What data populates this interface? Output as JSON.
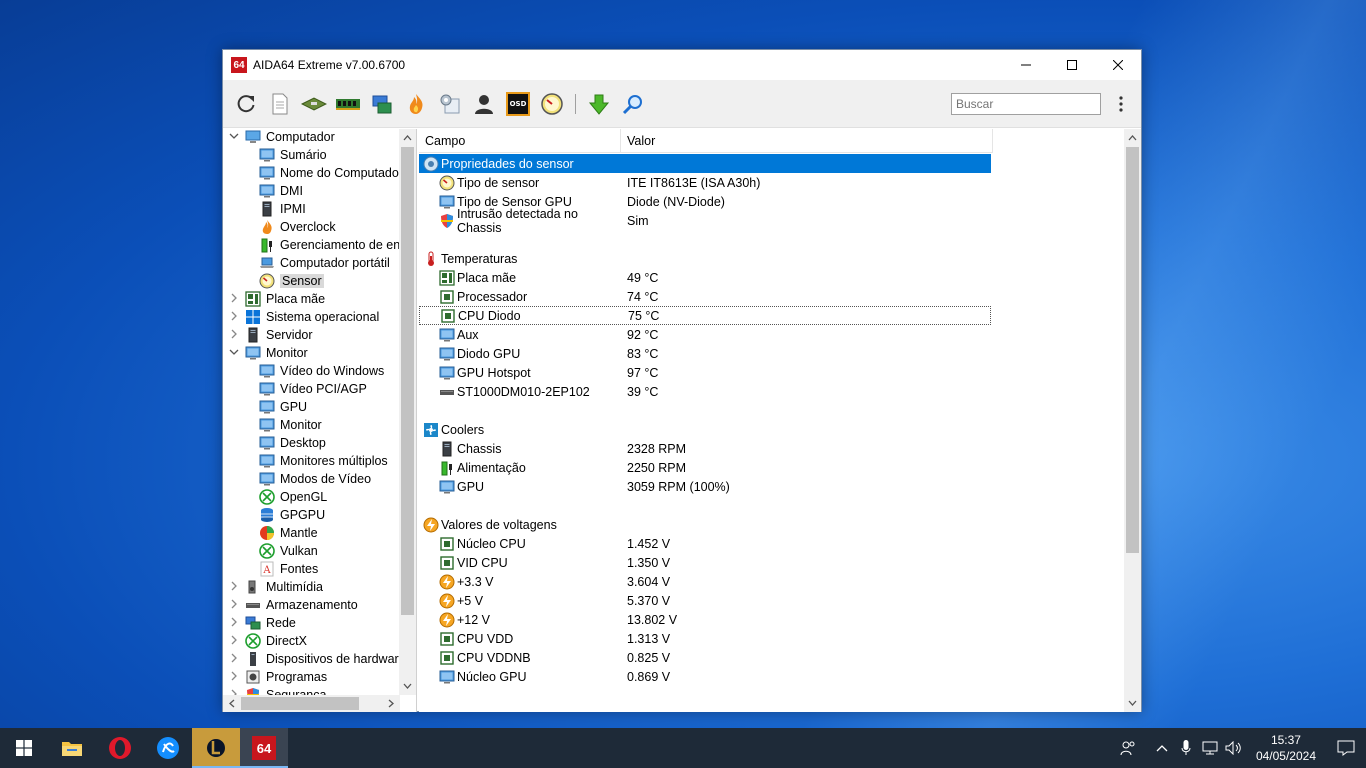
{
  "window": {
    "logo": "64",
    "title": "AIDA64 Extreme v7.00.6700"
  },
  "toolbar": {
    "search_placeholder": "Buscar",
    "buttons": [
      "refresh-icon",
      "report-icon",
      "motherboard-icon",
      "memory-icon",
      "network-icon",
      "flame-icon",
      "tools-icon",
      "user-icon",
      "osd-icon",
      "gauge-icon",
      "download-icon",
      "search-icon"
    ],
    "osd_label": "OSD"
  },
  "tree": {
    "items": [
      {
        "label": "Computador",
        "level": 0,
        "expanded": true,
        "icon": "computer-icon"
      },
      {
        "label": "Sumário",
        "level": 1,
        "icon": "monitor-icon"
      },
      {
        "label": "Nome do Computador",
        "level": 1,
        "icon": "monitor-icon"
      },
      {
        "label": "DMI",
        "level": 1,
        "icon": "monitor-icon"
      },
      {
        "label": "IPMI",
        "level": 1,
        "icon": "server-icon"
      },
      {
        "label": "Overclock",
        "level": 1,
        "icon": "flame-icon"
      },
      {
        "label": "Gerenciamento de energia",
        "level": 1,
        "icon": "battery-icon"
      },
      {
        "label": "Computador portátil",
        "level": 1,
        "icon": "laptop-icon"
      },
      {
        "label": "Sensor",
        "level": 1,
        "icon": "gauge-icon",
        "selected": true
      },
      {
        "label": "Placa mãe",
        "level": 0,
        "expanded": false,
        "icon": "motherboard-icon"
      },
      {
        "label": "Sistema operacional",
        "level": 0,
        "expanded": false,
        "icon": "windows-icon"
      },
      {
        "label": "Servidor",
        "level": 0,
        "expanded": false,
        "icon": "server-icon"
      },
      {
        "label": "Monitor",
        "level": 0,
        "expanded": true,
        "icon": "monitor-icon"
      },
      {
        "label": "Vídeo do Windows",
        "level": 1,
        "icon": "monitor-icon"
      },
      {
        "label": "Vídeo PCI/AGP",
        "level": 1,
        "icon": "monitor-icon"
      },
      {
        "label": "GPU",
        "level": 1,
        "icon": "monitor-icon"
      },
      {
        "label": "Monitor",
        "level": 1,
        "icon": "monitor-icon"
      },
      {
        "label": "Desktop",
        "level": 1,
        "icon": "monitor-icon"
      },
      {
        "label": "Monitores múltiplos",
        "level": 1,
        "icon": "monitor-icon"
      },
      {
        "label": "Modos de Vídeo",
        "level": 1,
        "icon": "monitor-icon"
      },
      {
        "label": "OpenGL",
        "level": 1,
        "icon": "xbox-icon"
      },
      {
        "label": "GPGPU",
        "level": 1,
        "icon": "database-icon"
      },
      {
        "label": "Mantle",
        "level": 1,
        "icon": "mantle-icon"
      },
      {
        "label": "Vulkan",
        "level": 1,
        "icon": "xbox-icon"
      },
      {
        "label": "Fontes",
        "level": 1,
        "icon": "font-icon"
      },
      {
        "label": "Multimídia",
        "level": 0,
        "expanded": false,
        "icon": "speaker-icon"
      },
      {
        "label": "Armazenamento",
        "level": 0,
        "expanded": false,
        "icon": "disk-icon"
      },
      {
        "label": "Rede",
        "level": 0,
        "expanded": false,
        "icon": "network-icon"
      },
      {
        "label": "DirectX",
        "level": 0,
        "expanded": false,
        "icon": "xbox-icon"
      },
      {
        "label": "Dispositivos de hardware",
        "level": 0,
        "expanded": false,
        "icon": "device-icon"
      },
      {
        "label": "Programas",
        "level": 0,
        "expanded": false,
        "icon": "programs-icon"
      },
      {
        "label": "Segurança",
        "level": 0,
        "expanded": false,
        "icon": "shield-icon"
      }
    ]
  },
  "table": {
    "col_field": "Campo",
    "col_value": "Valor",
    "rows": [
      {
        "type": "group",
        "field": "Propriedades do sensor",
        "value": "",
        "icon": "sensor-props-icon",
        "highlight": true
      },
      {
        "type": "item",
        "field": "Tipo de sensor",
        "value": "ITE IT8613E  (ISA A30h)",
        "icon": "gauge-icon"
      },
      {
        "type": "item",
        "field": "Tipo de Sensor GPU",
        "value": "Diode  (NV-Diode)",
        "icon": "monitor-icon"
      },
      {
        "type": "item",
        "field": "Intrusão detectada no Chassis",
        "value": "Sim",
        "icon": "shield-icon"
      },
      {
        "type": "blank"
      },
      {
        "type": "group",
        "field": "Temperaturas",
        "value": "",
        "icon": "thermometer-icon"
      },
      {
        "type": "item",
        "field": "Placa mãe",
        "value": "49 °C",
        "icon": "motherboard-icon"
      },
      {
        "type": "item",
        "field": "Processador",
        "value": "74 °C",
        "icon": "cpu-icon"
      },
      {
        "type": "item",
        "field": "CPU Diodo",
        "value": "75 °C",
        "icon": "cpu-icon",
        "focus": true
      },
      {
        "type": "item",
        "field": "Aux",
        "value": "92 °C",
        "icon": "monitor-icon"
      },
      {
        "type": "item",
        "field": "Diodo GPU",
        "value": "83 °C",
        "icon": "monitor-icon"
      },
      {
        "type": "item",
        "field": "GPU Hotspot",
        "value": "97 °C",
        "icon": "monitor-icon"
      },
      {
        "type": "item",
        "field": "ST1000DM010-2EP102",
        "value": "39 °C",
        "icon": "disk-icon"
      },
      {
        "type": "blank"
      },
      {
        "type": "group",
        "field": "Coolers",
        "value": "",
        "icon": "fan-icon"
      },
      {
        "type": "item",
        "field": "Chassis",
        "value": "2328 RPM",
        "icon": "server-icon"
      },
      {
        "type": "item",
        "field": "Alimentação",
        "value": "2250 RPM",
        "icon": "battery-icon"
      },
      {
        "type": "item",
        "field": "GPU",
        "value": "3059 RPM  (100%)",
        "icon": "monitor-icon"
      },
      {
        "type": "blank"
      },
      {
        "type": "group",
        "field": "Valores de voltagens",
        "value": "",
        "icon": "voltage-icon"
      },
      {
        "type": "item",
        "field": "Núcleo CPU",
        "value": "1.452 V",
        "icon": "cpu-icon"
      },
      {
        "type": "item",
        "field": "VID CPU",
        "value": "1.350 V",
        "icon": "cpu-icon"
      },
      {
        "type": "item",
        "field": "+3.3 V",
        "value": "3.604 V",
        "icon": "voltage-icon"
      },
      {
        "type": "item",
        "field": "+5 V",
        "value": "5.370 V",
        "icon": "voltage-icon"
      },
      {
        "type": "item",
        "field": "+12 V",
        "value": "13.802 V",
        "icon": "voltage-icon"
      },
      {
        "type": "item",
        "field": "CPU VDD",
        "value": "1.313 V",
        "icon": "cpu-icon"
      },
      {
        "type": "item",
        "field": "CPU VDDNB",
        "value": "0.825 V",
        "icon": "cpu-icon"
      },
      {
        "type": "item",
        "field": "Núcleo GPU",
        "value": "0.869 V",
        "icon": "monitor-icon"
      }
    ]
  },
  "taskbar": {
    "apps": [
      "windows-start-icon",
      "file-explorer-icon",
      "opera-icon",
      "battlenet-icon",
      "league-icon",
      "aida64-icon"
    ],
    "aida_label": "64",
    "time": "15:37",
    "date": "04/05/2024"
  },
  "colors": {
    "selection": "#0078d7",
    "aida_red": "#c8161d",
    "taskbar": "#1e2a38"
  }
}
